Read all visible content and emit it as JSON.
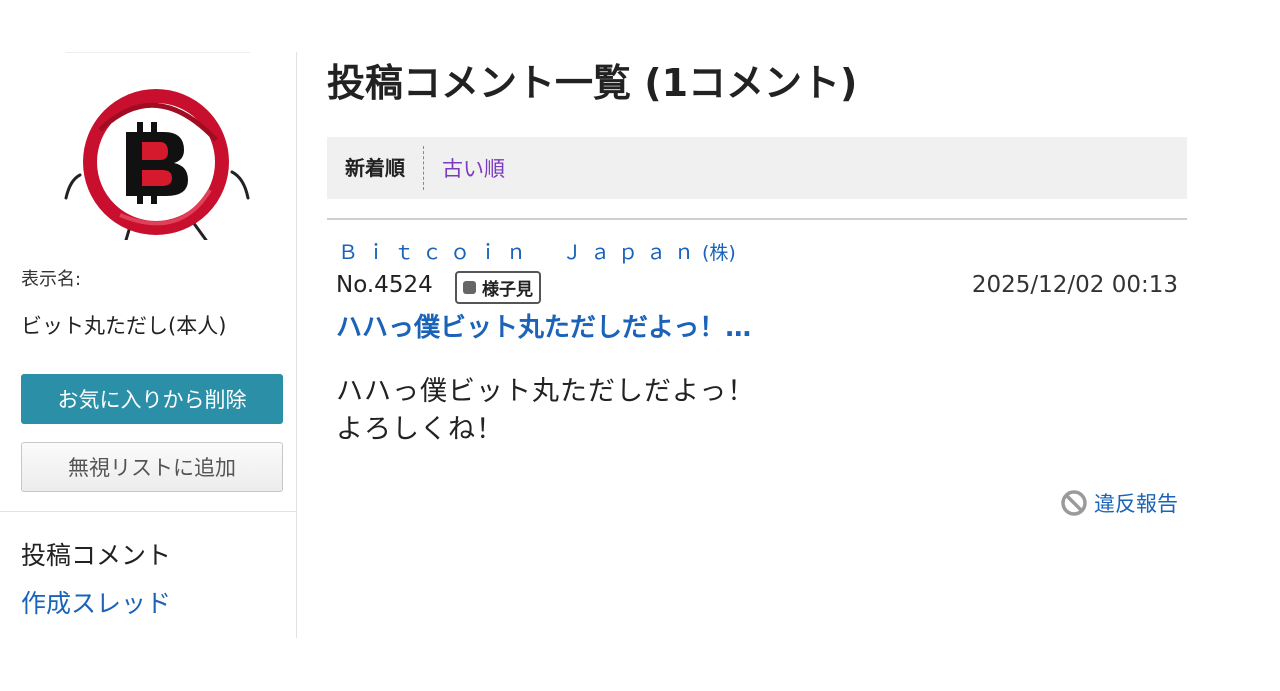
{
  "sidebar": {
    "avatar_alt": "bitcoin-mascot",
    "name_label": "表示名:",
    "name_value": "ビット丸ただし(本人)",
    "favorite_button": "お気に入りから削除",
    "ignore_button": "無視リストに追加",
    "nav_posted_comments": "投稿コメント",
    "nav_created_threads": "作成スレッド"
  },
  "main": {
    "title": "投稿コメント一覧 (1コメント)",
    "sort": {
      "newest": "新着順",
      "oldest": "古い順"
    },
    "comments": [
      {
        "author": "Ｂｉｔｃｏｉｎ　Ｊａｐａｎ",
        "author_suffix": "(株)",
        "number": "No.4524",
        "badge": "様子見",
        "timestamp": "2025/12/02 00:13",
        "title": "ハハっ僕ビット丸ただしだよっ！…",
        "body_line1": "ハハっ僕ビット丸ただしだよっ！",
        "body_line2": "よろしくね！",
        "report": "違反報告"
      }
    ]
  },
  "colors": {
    "link": "#1a63b8",
    "primary_button": "#2b8fa8",
    "visited_link": "#7a3bbf",
    "sort_bar_bg": "#f0f0f0",
    "avatar_ring": "#c8102e"
  },
  "icons": {
    "report": "prohibited-icon",
    "badge": "square-dot-icon"
  }
}
